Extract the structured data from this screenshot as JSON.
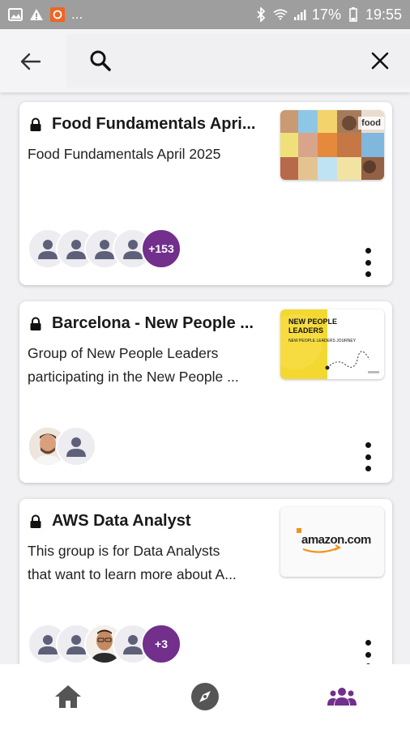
{
  "status_bar": {
    "battery": "17%",
    "time": "19:55",
    "overflow": "..."
  },
  "search": {
    "placeholder": "",
    "value": ""
  },
  "groups": [
    {
      "title": "Food Fundamentals Apri...",
      "description_lines": [
        "Food Fundamentals April 2025"
      ],
      "member_count_badge": "+153",
      "thumb_text": "food"
    },
    {
      "title": "Barcelona - New People ...",
      "description_lines": [
        "Group of New People Leaders",
        "participating in the New People ..."
      ],
      "thumb_title": "NEW PEOPLE LEADERS",
      "thumb_subtitle": "NEW PEOPLE LEADERS JOURNEY"
    },
    {
      "title": "AWS Data Analyst",
      "description_lines": [
        "This group is for Data Analysts",
        "that want to learn more about A..."
      ],
      "member_count_badge": "+3",
      "thumb_text": "amazon.com"
    }
  ],
  "bottom_nav": {
    "items": [
      "home-icon",
      "explore-icon",
      "groups-icon"
    ],
    "active_color": "#722f8c",
    "inactive_color": "#555555"
  },
  "colors": {
    "accent": "#722f8c",
    "avatar_bg": "#ececf1",
    "person_icon": "#5d6078"
  }
}
